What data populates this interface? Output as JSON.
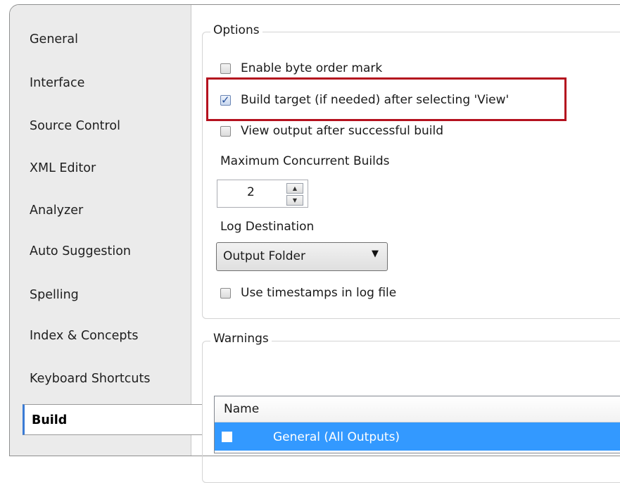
{
  "nav": {
    "items": [
      {
        "label": "General"
      },
      {
        "label": "Interface"
      },
      {
        "label": "Source Control"
      },
      {
        "label": "XML Editor"
      },
      {
        "label": "Analyzer"
      },
      {
        "label": "Auto Suggestion"
      },
      {
        "label": "Spelling"
      },
      {
        "label": "Index & Concepts"
      },
      {
        "label": "Keyboard Shortcuts"
      },
      {
        "label": "Build",
        "active": true
      }
    ]
  },
  "options": {
    "title": "Options",
    "enable_bom": {
      "label": "Enable byte order mark",
      "checked": false
    },
    "build_target": {
      "label": "Build target (if needed) after selecting 'View'",
      "checked": true
    },
    "view_output": {
      "label": "View output after successful build",
      "checked": false
    },
    "max_builds_label": "Maximum Concurrent Builds",
    "max_builds_value": "2",
    "log_destination_label": "Log Destination",
    "log_destination_value": "Output Folder",
    "timestamps": {
      "label": "Use timestamps in log file",
      "checked": false
    }
  },
  "warnings": {
    "title": "Warnings",
    "table": {
      "header_name": "Name",
      "rows": [
        {
          "label": "General (All Outputs)",
          "selected": true
        }
      ]
    }
  },
  "colors": {
    "highlight_border": "#b4111e",
    "selection": "#3399ff",
    "nav_background": "#ebebeb"
  }
}
